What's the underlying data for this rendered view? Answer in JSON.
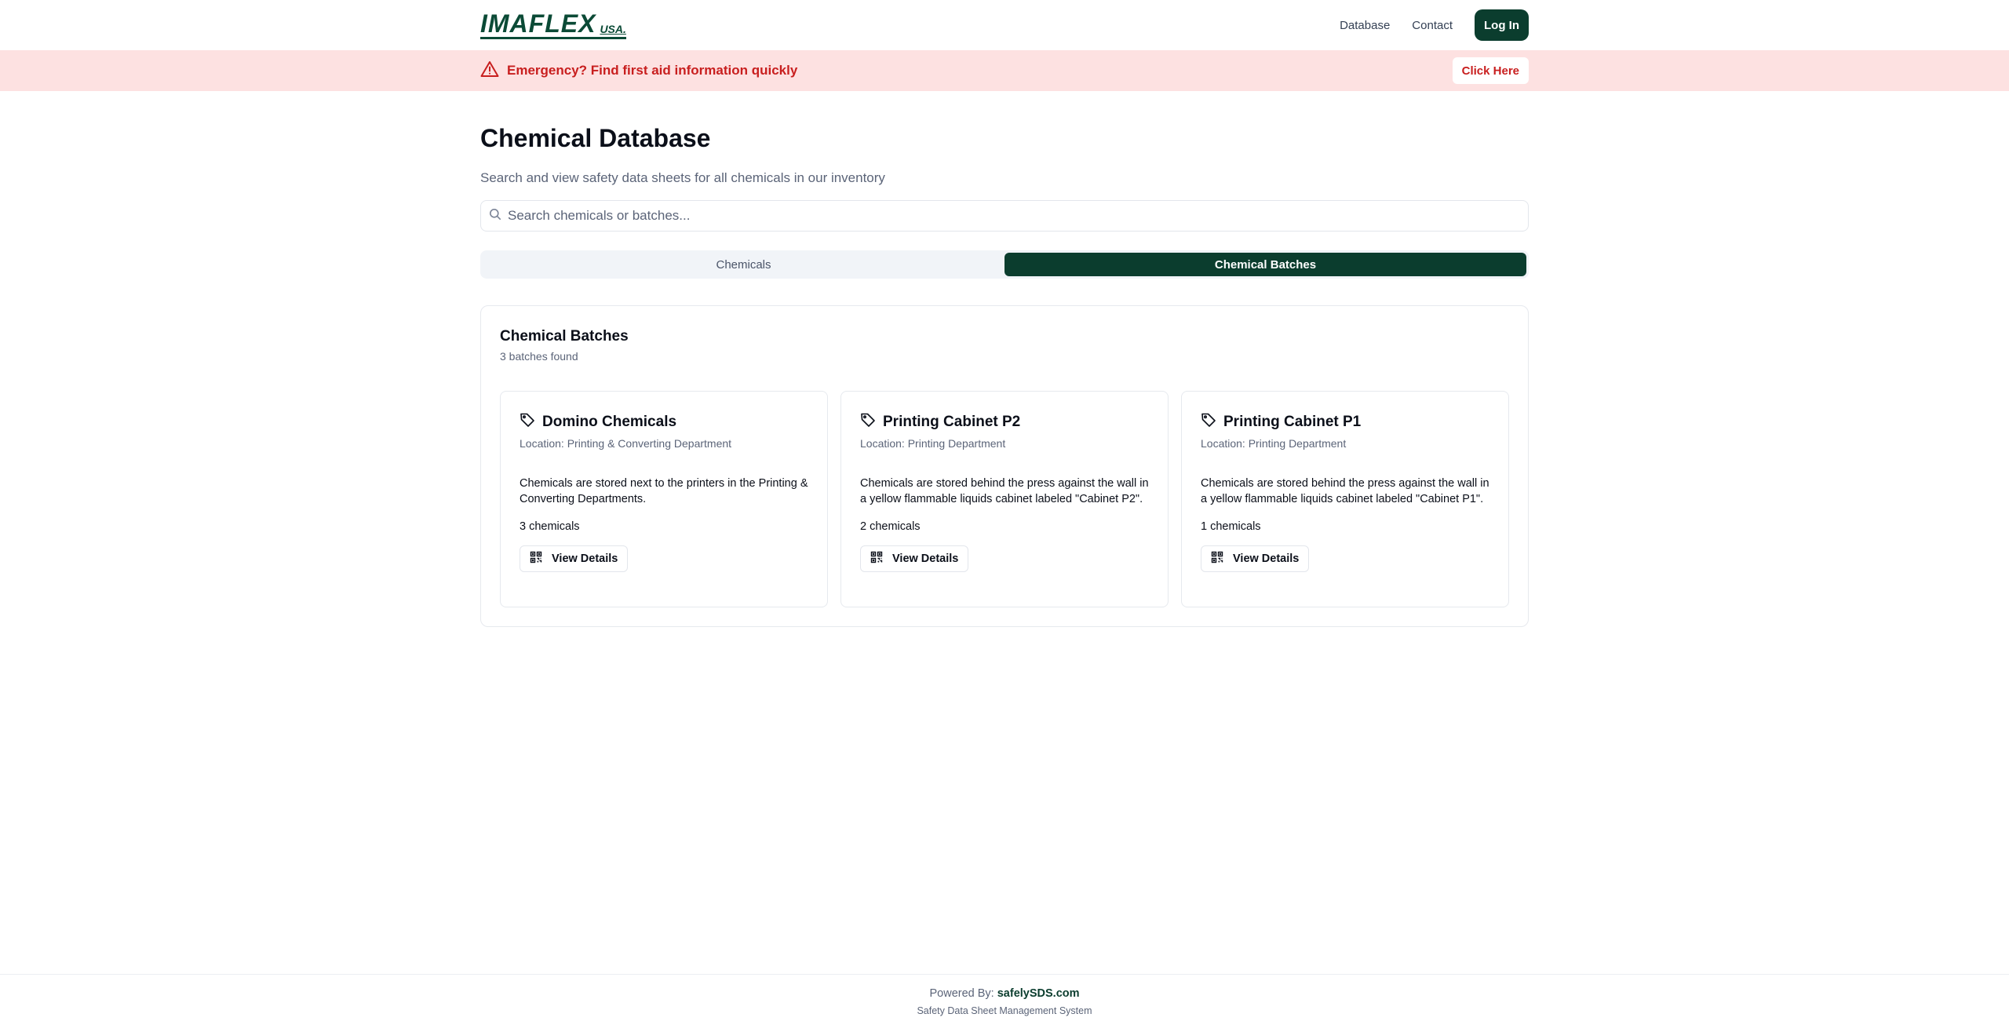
{
  "header": {
    "logo_main": "IMAFLEX",
    "logo_sub": "USA.",
    "nav": [
      {
        "label": "Database"
      },
      {
        "label": "Contact"
      }
    ],
    "login_label": "Log In"
  },
  "banner": {
    "text": "Emergency? Find first aid information quickly",
    "button_label": "Click Here",
    "color": "#c81e1e",
    "background": "#fde1e1"
  },
  "main": {
    "title": "Chemical Database",
    "subtitle": "Search and view safety data sheets for all chemicals in our inventory",
    "search": {
      "placeholder": "Search chemicals or batches...",
      "value": ""
    },
    "tabs": [
      {
        "label": "Chemicals",
        "active": false
      },
      {
        "label": "Chemical Batches",
        "active": true
      }
    ],
    "panel": {
      "title": "Chemical Batches",
      "count": "3 batches found",
      "cards": [
        {
          "title": "Domino Chemicals",
          "location": "Location: Printing & Converting Department",
          "description": "Chemicals are stored next to the printers in the Printing & Converting Departments.",
          "count": "3 chemicals",
          "button_label": "View Details"
        },
        {
          "title": "Printing Cabinet P2",
          "location": "Location: Printing Department",
          "description": "Chemicals are stored behind the press against the wall in a yellow flammable liquids cabinet labeled \"Cabinet P2\".",
          "count": "2 chemicals",
          "button_label": "View Details"
        },
        {
          "title": "Printing Cabinet P1",
          "location": "Location: Printing Department",
          "description": "Chemicals are stored behind the press against the wall in a yellow flammable liquids cabinet labeled \"Cabinet P1\".",
          "count": "1 chemicals",
          "button_label": "View Details"
        }
      ]
    }
  },
  "footer": {
    "powered_prefix": "Powered By:",
    "powered_brand": "safelySDS.com",
    "tagline": "Safety Data Sheet Management System"
  },
  "colors": {
    "brand": "#0b3d2e",
    "muted_text": "#5b6478"
  },
  "icons": {
    "banner": "alert-triangle-icon",
    "search": "search-icon",
    "card": "tag-icon",
    "details": "qr-code-icon"
  }
}
